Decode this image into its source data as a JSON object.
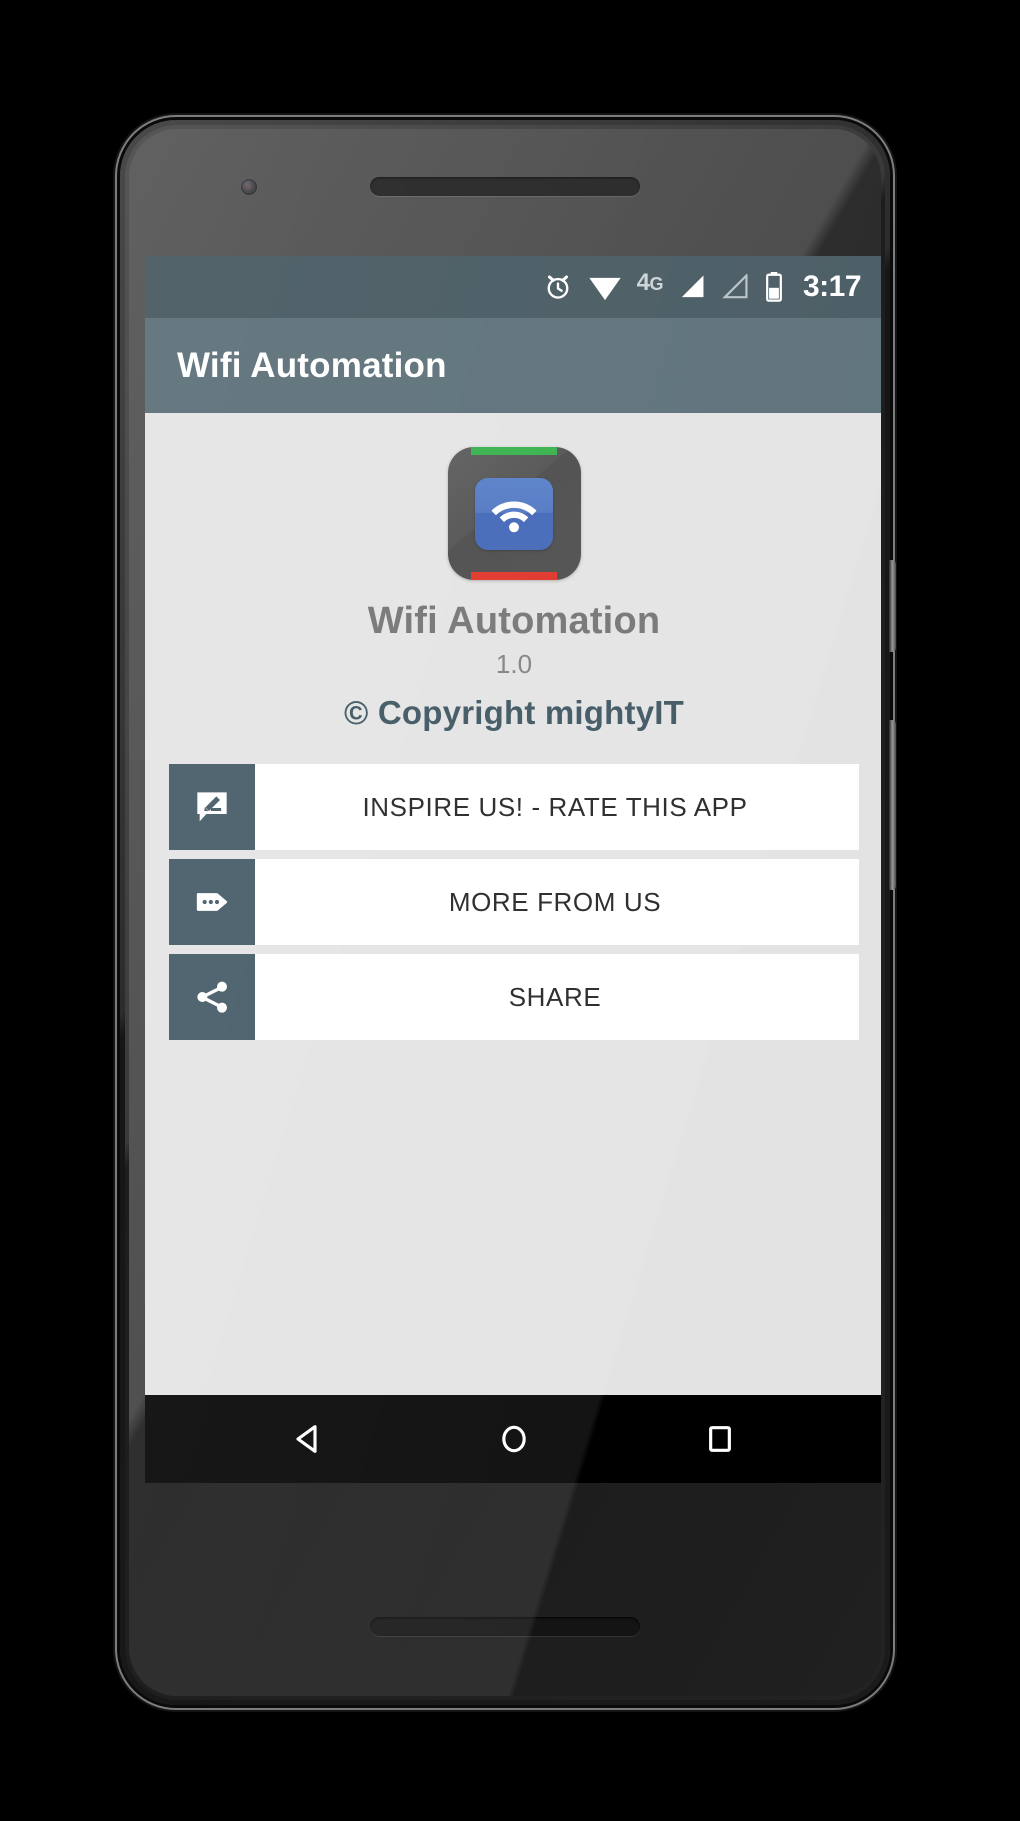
{
  "device": {
    "frame_name": "android-phone-frame",
    "camera_icon": "front-camera-icon",
    "earpiece_icon": "earpiece-speaker",
    "bottom_speaker_icon": "bottom-speaker",
    "power_button": "power-button",
    "volume_button": "volume-rocker"
  },
  "status_bar": {
    "background": "#3f525a",
    "alarm_icon": "alarm-clock-icon",
    "wifi_icon": "wifi-icon",
    "network_type": "4G",
    "network_type_main": "4",
    "network_type_sub": "G",
    "signal_icon_1": "signal-bars-filled-icon",
    "signal_icon_2": "signal-bars-empty-icon",
    "battery_icon": "battery-half-icon",
    "time": "3:17"
  },
  "app_bar": {
    "title": "Wifi Automation",
    "background": "#556a73"
  },
  "main": {
    "background": "#e3e3e3",
    "app_icon": {
      "name": "wifi-automation-app-icon",
      "top_bar_color": "#2eae44",
      "bottom_bar_color": "#e02b20",
      "tile_color": "#3a61b4",
      "glyph": "wifi-icon"
    },
    "app_name": "Wifi Automation",
    "version": "1.0",
    "copyright": "© Copyright mightyIT",
    "copyright_color": "#37505c",
    "actions": [
      {
        "label": "INSPIRE US! - RATE THIS APP",
        "icon": "rate-review-icon",
        "name": "rate-this-app-button"
      },
      {
        "label": "MORE FROM US",
        "icon": "more-tag-icon",
        "name": "more-from-us-button"
      },
      {
        "label": "SHARE",
        "icon": "share-icon",
        "name": "share-button"
      }
    ],
    "action_icon_background": "#3f5662"
  },
  "nav_bar": {
    "background": "#000000",
    "back_icon": "back-triangle-icon",
    "home_icon": "home-circle-icon",
    "recents_icon": "recents-square-icon"
  }
}
